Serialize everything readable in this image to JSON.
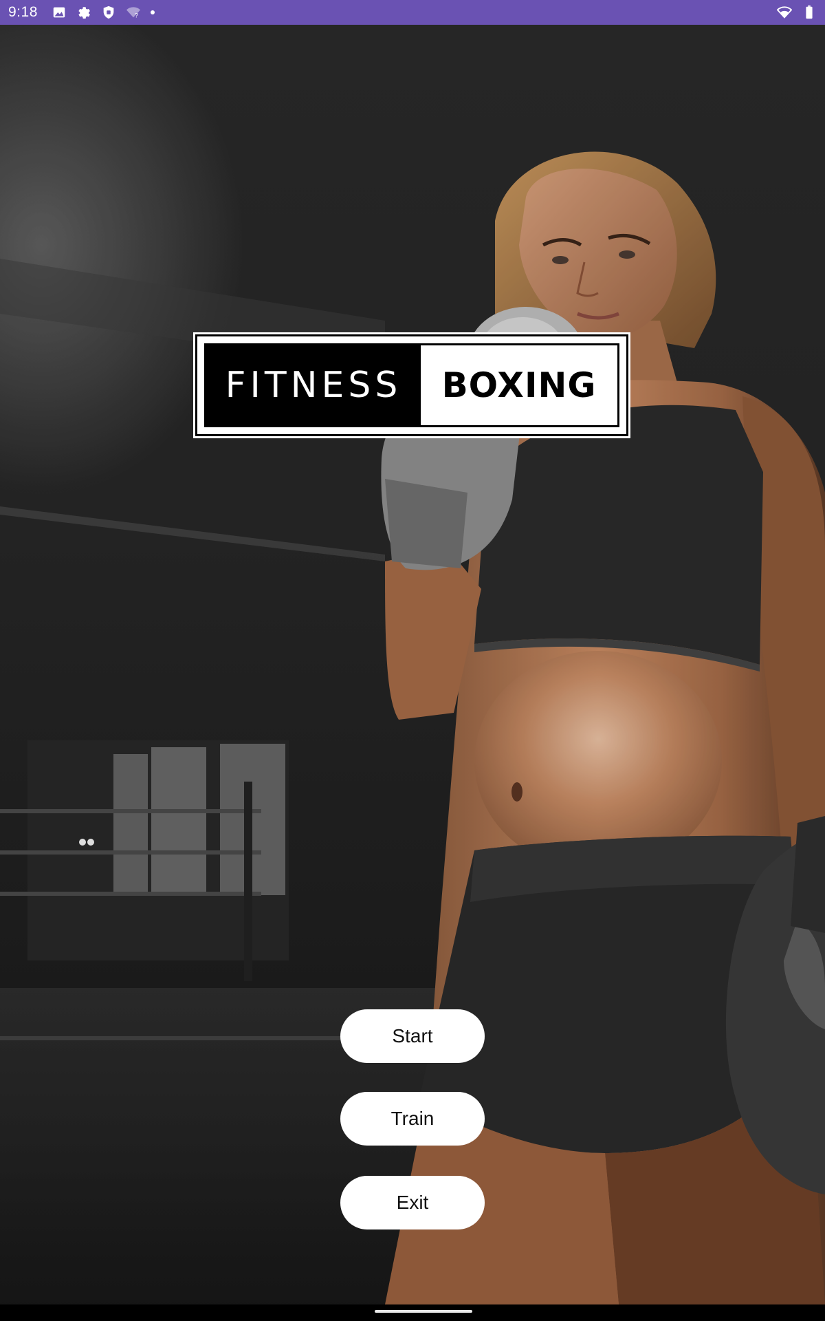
{
  "status_bar": {
    "time": "9:18",
    "left_icons": [
      "image-icon",
      "settings-gear-icon",
      "shield-icon",
      "wifi-question-icon",
      "dot-icon"
    ],
    "right_icons": [
      "wifi-icon",
      "battery-icon"
    ],
    "background_color": "#6a52b3"
  },
  "logo": {
    "left_text": "FITNESS",
    "right_text": "BOXING"
  },
  "menu": {
    "start_label": "Start",
    "train_label": "Train",
    "exit_label": "Exit"
  },
  "background": {
    "description_icon": "boxer-photo-background"
  }
}
